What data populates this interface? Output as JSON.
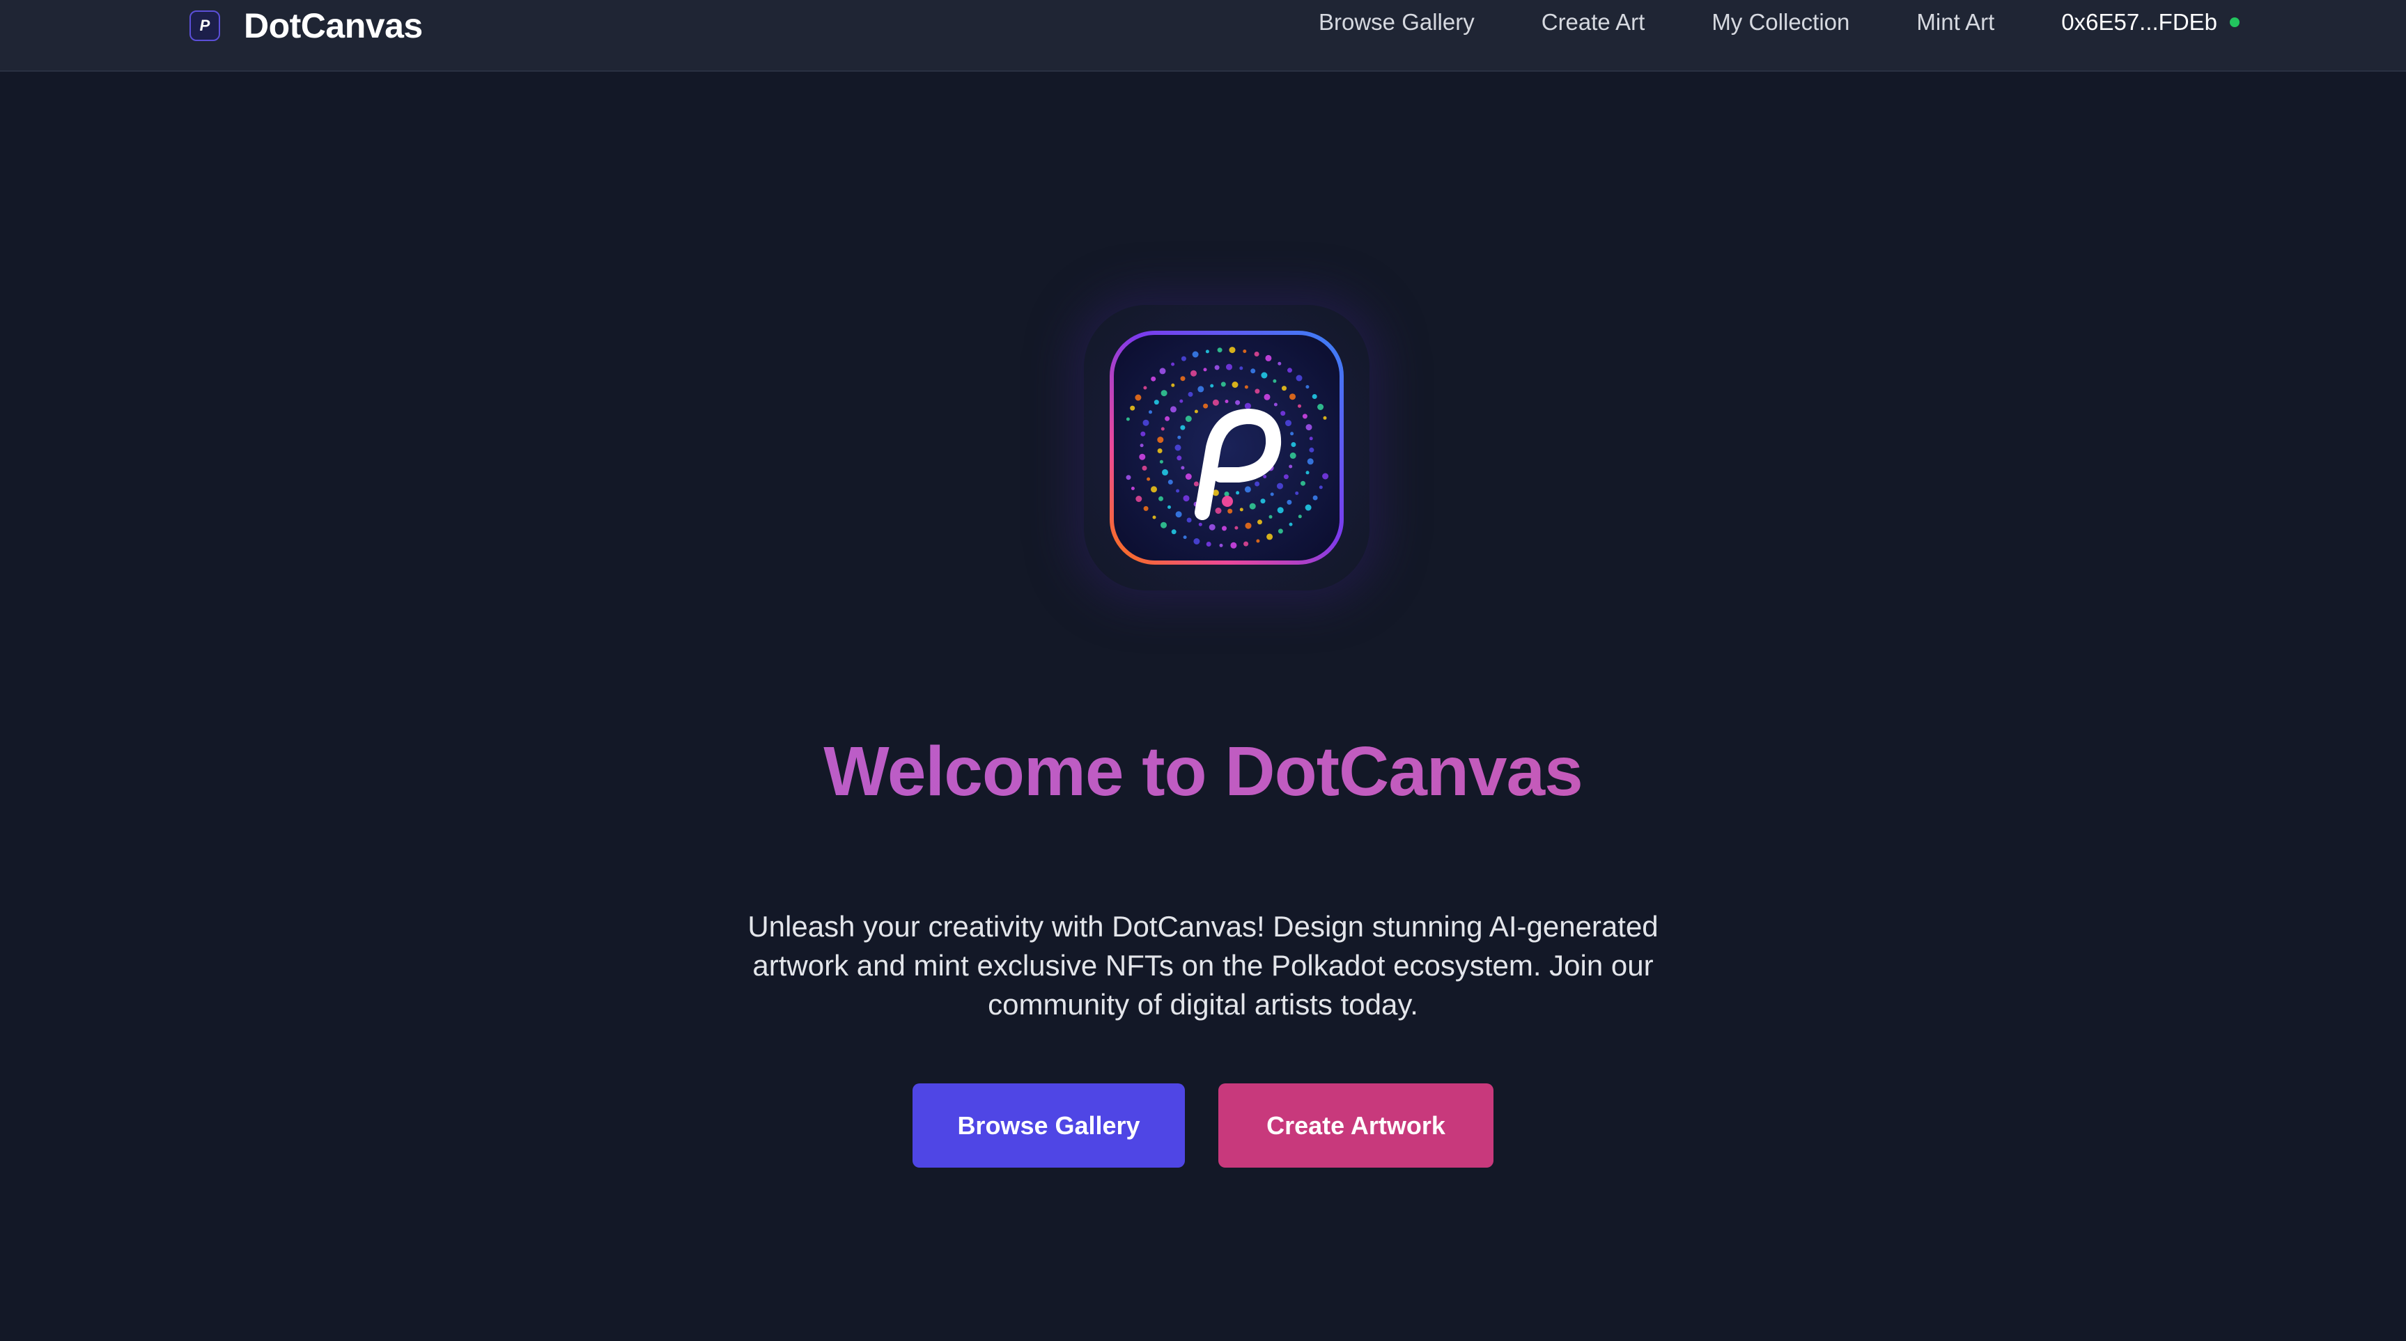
{
  "navbar": {
    "brand_name": "DotCanvas",
    "links": [
      {
        "label": "Browse Gallery"
      },
      {
        "label": "Create Art"
      },
      {
        "label": "My Collection"
      },
      {
        "label": "Mint Art"
      }
    ],
    "wallet_address": "0x6E57...FDEb",
    "wallet_status_color": "#22c55e"
  },
  "hero": {
    "logo_icon": "polkadot-p-icon",
    "title": "Welcome to DotCanvas",
    "description": "Unleash your creativity with DotCanvas! Design stunning AI-generated artwork and mint exclusive NFTs on the Polkadot ecosystem. Join our community of digital artists today.",
    "primary_button": "Browse Gallery",
    "secondary_button": "Create Artwork"
  },
  "colors": {
    "background": "#131827",
    "navbar": "#1f2534",
    "title_gradient_start": "#b25ed3",
    "title_gradient_end": "#d055a3",
    "primary_button": "#4f46e5",
    "secondary_button": "#c8397c"
  }
}
